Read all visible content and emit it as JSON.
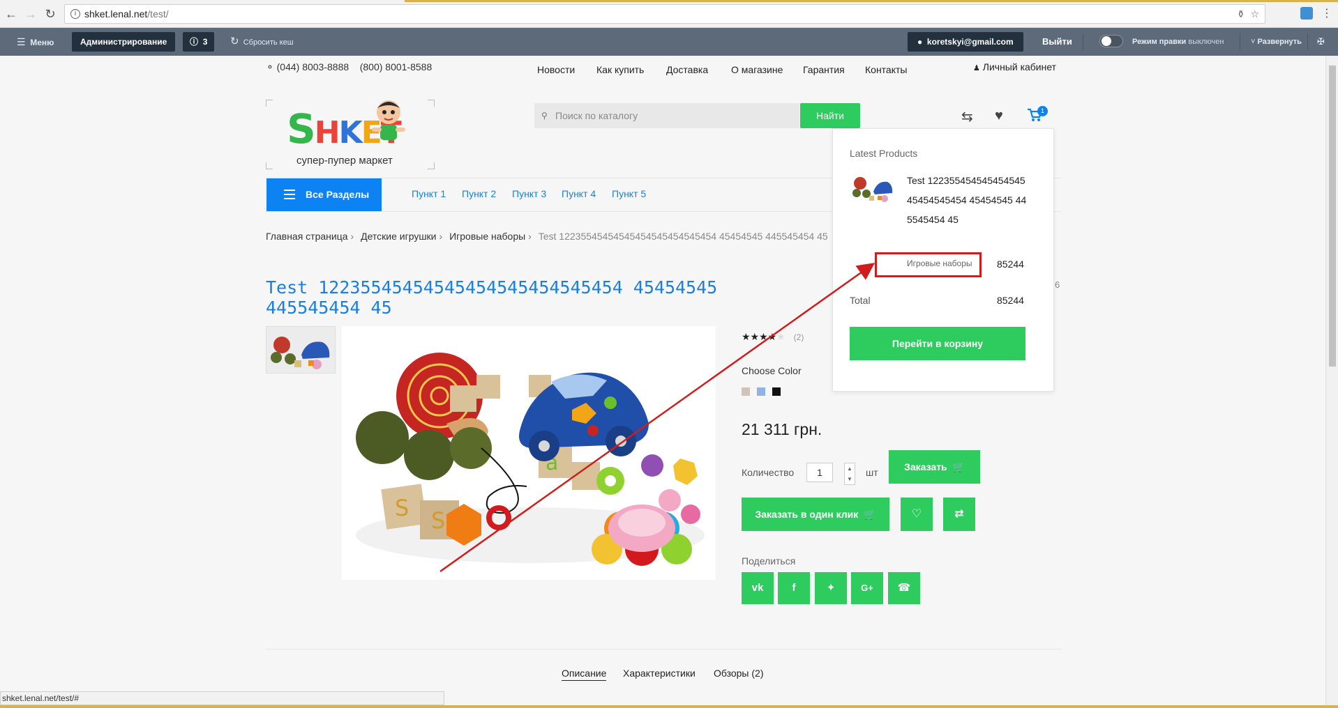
{
  "browser": {
    "url_host": "shket.lenal.net",
    "url_path": "/test/",
    "status_url": "shket.lenal.net/test/#"
  },
  "admin": {
    "menu": "Меню",
    "administration": "Администрирование",
    "notifications_count": "3",
    "reset_cache": "Сбросить кеш",
    "user_email": "koretskyi@gmail.com",
    "logout": "Выйти",
    "edit_mode_label": "Режим правки",
    "edit_mode_state": "выключен",
    "expand": "Развернуть"
  },
  "header": {
    "phone1": "(044) 8003-8888",
    "phone2": "(800) 8001-8588",
    "nav": [
      "Новости",
      "Как купить",
      "Доставка",
      "О магазине",
      "Гарантия",
      "Контакты"
    ],
    "cabinet": "Личный кабинет",
    "logo_text": "SHKET",
    "logo_sub": "супер-пупер маркет",
    "search_placeholder": "Поиск по каталогу",
    "search_button": "Найти",
    "cart_count": "1"
  },
  "catbar": {
    "all_sections": "Все Разделы",
    "items": [
      "Пункт 1",
      "Пункт 2",
      "Пункт 3",
      "Пункт 4",
      "Пункт 5"
    ]
  },
  "breadcrumbs": [
    "Главная страница",
    "Детские игрушки",
    "Игровые наборы",
    "Test 12235545454545454545454545454 45454545 445545454 45"
  ],
  "product": {
    "title": "Test 12235545454545454545454545454 45454545 445545454 45",
    "rating_stars": 4,
    "rating_count": "(2)",
    "choose_color": "Choose Color",
    "colors": [
      "#cfc4b7",
      "#8fb3e3",
      "#111111"
    ],
    "price": "21 311 грн.",
    "quantity_label": "Количество",
    "quantity_value": "1",
    "unit": "шт",
    "order_button": "Заказать",
    "one_click_button": "Заказать в один клик",
    "share_label": "Поделиться",
    "partial_side_text": "6"
  },
  "cart_popup": {
    "header": "Latest Products",
    "item_name": "Test 12235545454545454545454545454 45454545 445545454 45",
    "item_category": "Игровые наборы",
    "item_price": "85244",
    "total_label": "Total",
    "total_value": "85244",
    "checkout_button": "Перейти в корзину"
  },
  "tabs": [
    "Описание",
    "Характеристики",
    "Обзоры (2)"
  ],
  "colors": {
    "green": "#2ecc5f",
    "blue": "#0d82f2",
    "admin_bar": "#5d6a79",
    "highlight_red": "#d21c1c"
  }
}
